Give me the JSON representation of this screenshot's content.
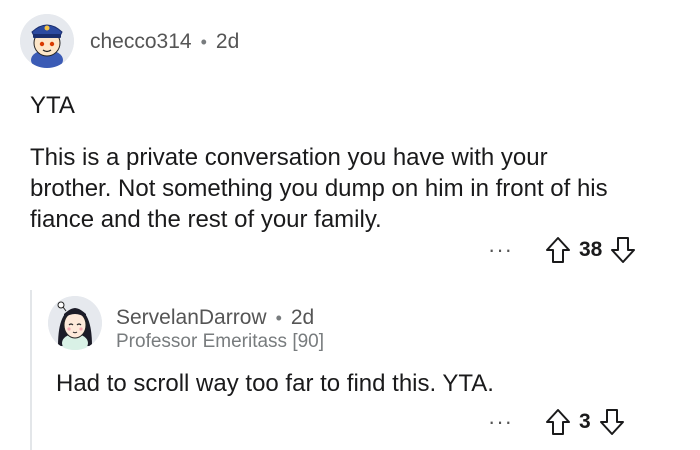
{
  "comments": [
    {
      "username": "checco314",
      "age": "2d",
      "body_lines": [
        "YTA",
        "This is a private conversation you have with your",
        "brother.  Not something you dump on him in front of his",
        "fiance and the rest of your family."
      ],
      "more": "···",
      "votes": "38",
      "avatar_icon": "police-hat-avatar-icon"
    },
    {
      "username": "ServelanDarrow",
      "age": "2d",
      "flair": "Professor Emeritass [90]",
      "body_lines": [
        "Had to scroll way too far to find this. YTA."
      ],
      "more": "···",
      "votes": "3",
      "avatar_icon": "girl-avatar-icon"
    }
  ],
  "colors": {
    "text": "#1a1a1b",
    "muted": "#787c7e",
    "thread_line": "#e3e6e9"
  }
}
